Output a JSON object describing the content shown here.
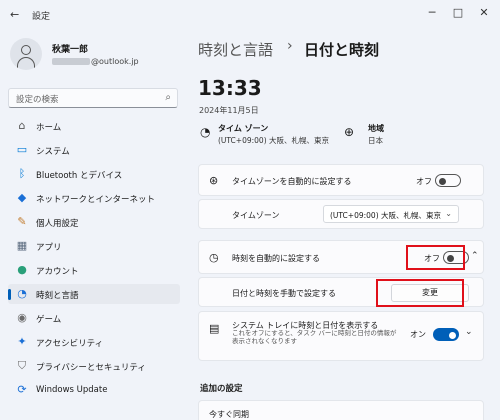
{
  "window": {
    "title": "設定",
    "back_glyph": "←",
    "minimize_glyph": "─",
    "maximize_glyph": "□",
    "close_glyph": "✕"
  },
  "user": {
    "name": "秋葉一郎",
    "email_suffix": "@outlook.jp"
  },
  "search": {
    "placeholder": "設定の検索"
  },
  "sidebar": {
    "items": [
      {
        "label": "ホーム",
        "icon": "home-icon",
        "glyph": "⌂",
        "color": "#555555"
      },
      {
        "label": "システム",
        "icon": "monitor-icon",
        "glyph": "▭",
        "color": "#0078d4"
      },
      {
        "label": "Bluetooth とデバイス",
        "icon": "bluetooth-icon",
        "glyph": "ᛒ",
        "color": "#0078d4"
      },
      {
        "label": "ネットワークとインターネット",
        "icon": "wifi-icon",
        "glyph": "◆",
        "color": "#1a6fd6"
      },
      {
        "label": "個人用設定",
        "icon": "brush-icon",
        "glyph": "✎",
        "color": "#c27c2e"
      },
      {
        "label": "アプリ",
        "icon": "apps-icon",
        "glyph": "▦",
        "color": "#5a6a7e"
      },
      {
        "label": "アカウント",
        "icon": "account-icon",
        "glyph": "●",
        "color": "#2aa07a"
      },
      {
        "label": "時刻と言語",
        "icon": "globe-clock-icon",
        "glyph": "◔",
        "color": "#1a6fd6",
        "selected": true
      },
      {
        "label": "ゲーム",
        "icon": "gamepad-icon",
        "glyph": "◉",
        "color": "#6b6b6b"
      },
      {
        "label": "アクセシビリティ",
        "icon": "accessibility-icon",
        "glyph": "✦",
        "color": "#1a6fd6"
      },
      {
        "label": "プライバシーとセキュリティ",
        "icon": "shield-icon",
        "glyph": "⛉",
        "color": "#6b6b6b"
      },
      {
        "label": "Windows Update",
        "icon": "update-icon",
        "glyph": "⟳",
        "color": "#1a6fd6"
      }
    ]
  },
  "breadcrumb": {
    "parent": "時刻と言語",
    "separator": "›",
    "current": "日付と時刻"
  },
  "clock": {
    "time": "13:33",
    "date": "2024年11月5日"
  },
  "timezone_summary": {
    "label": "タイム ゾーン",
    "value": "(UTC+09:00) 大阪、札幌、東京"
  },
  "region_summary": {
    "label": "地域",
    "value": "日本"
  },
  "settings": {
    "auto_timezone": {
      "label": "タイムゾーンを自動的に設定する",
      "state": "オフ",
      "on": false
    },
    "timezone": {
      "label": "タイムゾーン",
      "value": "(UTC+09:00) 大阪、札幌、東京"
    },
    "auto_time": {
      "label": "時刻を自動的に設定する",
      "state": "オフ",
      "on": false
    },
    "manual_time": {
      "label": "日付と時刻を手動で設定する",
      "button": "変更"
    },
    "tray": {
      "label": "システム トレイに時刻と日付を表示する",
      "description": "これをオフにすると、タスク バーに時刻と日付の情報が表示されなくなります",
      "state": "オン",
      "on": true
    }
  },
  "additional": {
    "heading": "追加の設定",
    "sync_label": "今すぐ同期"
  },
  "colors": {
    "accent": "#005fb8",
    "highlight": "#e0101a"
  }
}
